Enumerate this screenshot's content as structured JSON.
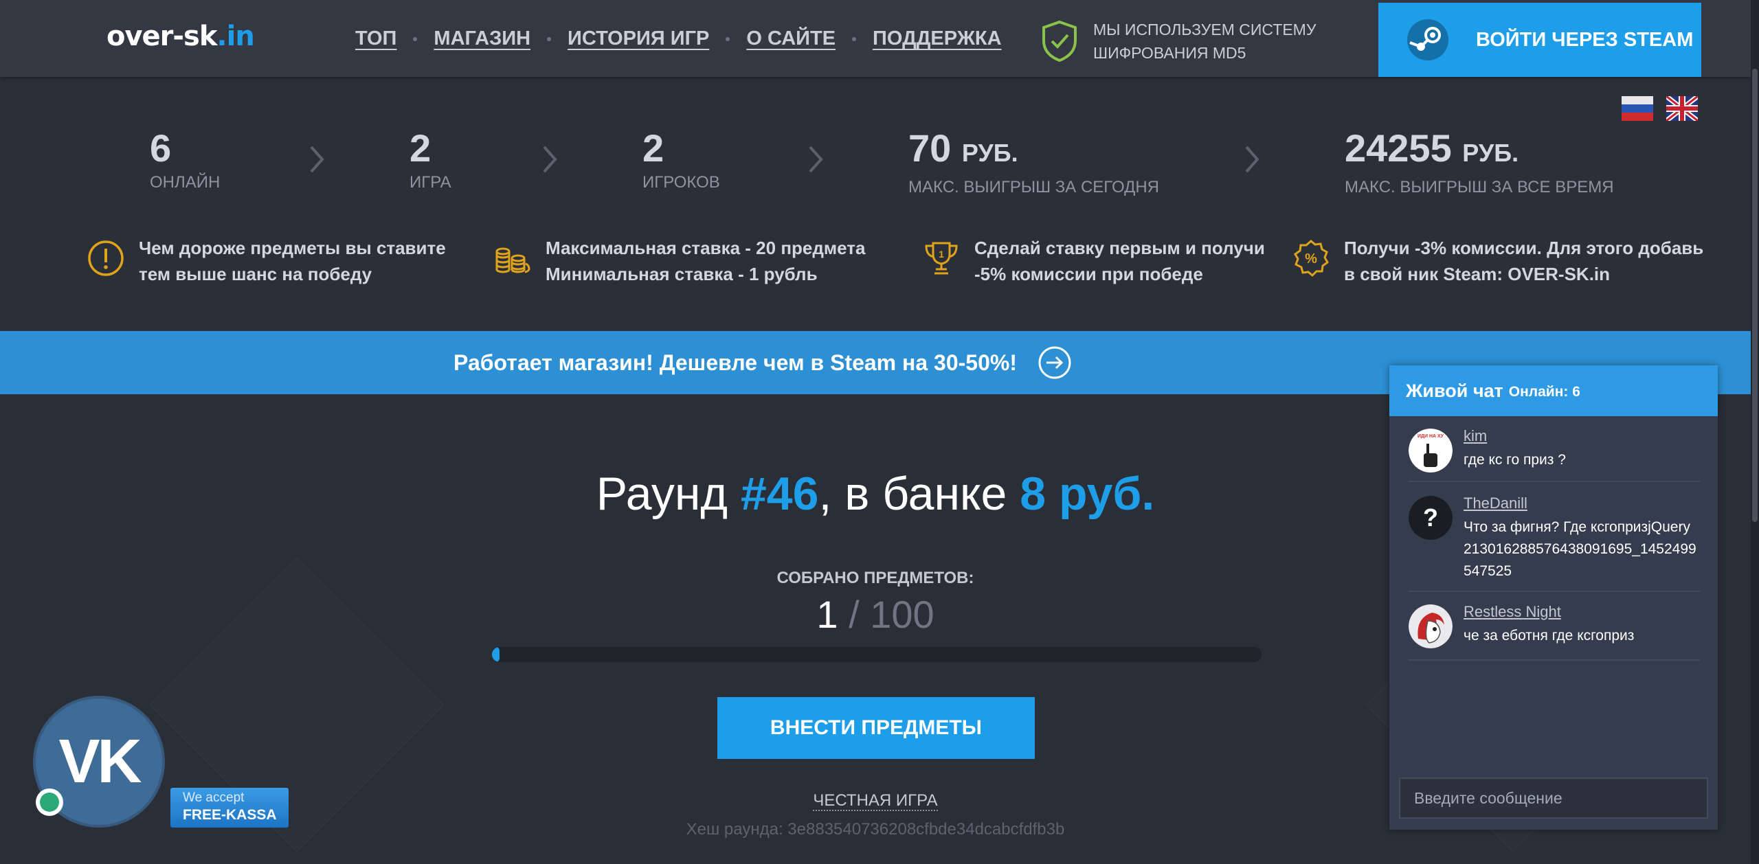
{
  "header": {
    "logo_main": "over-sk",
    "logo_tld": ".in",
    "nav": [
      "ТОП",
      "МАГАЗИН",
      "ИСТОРИЯ ИГР",
      "О САЙТЕ",
      "ПОДДЕРЖКА"
    ],
    "md5_line1": "МЫ ИСПОЛЬЗУЕМ СИСТЕМУ",
    "md5_line2": "ШИФРОВАНИЯ MD5",
    "steam_login": "ВОЙТИ ЧЕРЕЗ STEAM"
  },
  "stats": [
    {
      "value": "6",
      "label": "ОНЛАЙН"
    },
    {
      "value": "2",
      "label": "ИГРА"
    },
    {
      "value": "2",
      "label": "ИГРОКОВ"
    },
    {
      "value": "70",
      "currency": "РУБ.",
      "label": "МАКС. ВЫИГРЫШ ЗА СЕГОДНЯ"
    },
    {
      "value": "24255",
      "currency": "РУБ.",
      "label": "МАКС. ВЫИГРЫШ ЗА ВСЕ ВРЕМЯ"
    }
  ],
  "info": [
    {
      "line1": "Чем дороже предметы вы ставите",
      "line2": "тем выше шанс на победу"
    },
    {
      "line1": "Максимальная ставка - 20 предмета",
      "line2": "Минимальная ставка - 1 рубль"
    },
    {
      "line1": "Сделай ставку первым и получи",
      "line2": "-5% комиссии при победе"
    },
    {
      "line1": "Получи -3% комиссии. Для этого добавь",
      "line2": "в свой ник Steam: OVER-SK.in"
    }
  ],
  "banner": "Работает магазин! Дешевле чем в Steam на 30-50%!",
  "round": {
    "prefix": "Раунд ",
    "number": "#46",
    "middle": ", в банке ",
    "bank": "8 руб.",
    "collected_label": "СОБРАНО ПРЕДМЕТОВ:",
    "collected": "1",
    "collected_rest": " / 100",
    "progress_fraction": 0.01,
    "deposit_button": "ВНЕСТИ ПРЕДМЕТЫ",
    "fair_game": "ЧЕСТНАЯ ИГРА",
    "hash": "Хеш раунда: 3e883540736208cfbde34dcabcfdfb3b"
  },
  "vk": {
    "label": "VK"
  },
  "free_kassa": {
    "line1": "We accept",
    "line2": "FREE-KASSA"
  },
  "chat": {
    "title": "Живой чат",
    "online": "Онлайн: 6",
    "messages": [
      {
        "name": "kim",
        "text": "где кс го приз ?"
      },
      {
        "name": "TheDanill",
        "text": "Что за фигня? Где ксгопризjQuery213016288576438091695_1452499547525"
      },
      {
        "name": "Restless Night",
        "text": "че за еботня где ксгоприз"
      }
    ],
    "placeholder": "Введите сообщение"
  },
  "colors": {
    "accent": "#1e9de8",
    "banner": "#2d8fd4",
    "bg": "#2b2f38",
    "header": "#333842",
    "icon_gold": "#e0a31c"
  }
}
